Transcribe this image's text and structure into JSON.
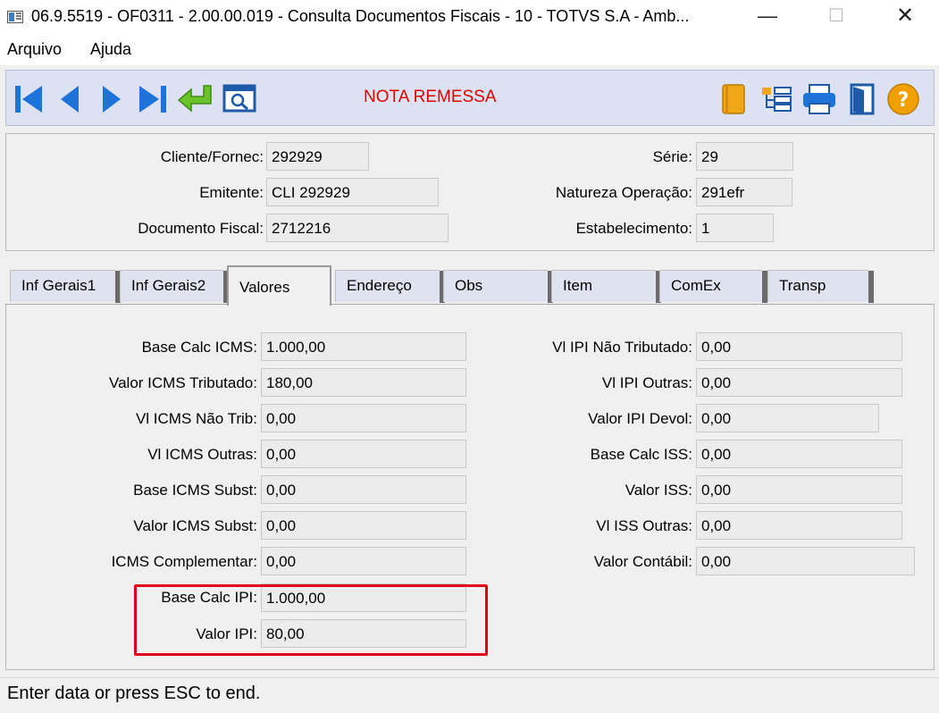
{
  "window": {
    "title": "06.9.5519 - OF0311 - 2.00.00.019 - Consulta Documentos Fiscais - 10 - TOTVS S.A - Amb...",
    "controls": {
      "minimize": "—",
      "maximize": "☐",
      "close": "✕"
    }
  },
  "menu": [
    {
      "label": "Arquivo"
    },
    {
      "label": "Ajuda"
    }
  ],
  "toolbar": {
    "title": "NOTA REMESSA",
    "buttons": [
      "first-record",
      "previous-record",
      "next-record",
      "last-record",
      "go-to",
      "search"
    ],
    "right_buttons": [
      "notebook",
      "tree",
      "print",
      "exit",
      "help"
    ],
    "help_glyph": "?"
  },
  "header": {
    "cliente_label": "Cliente/Fornec:",
    "cliente_value": "292929",
    "emitente_label": "Emitente:",
    "emitente_value": "CLI 292929",
    "documento_label": "Documento Fiscal:",
    "documento_value": "2712216",
    "serie_label": "Série:",
    "serie_value": "29",
    "natureza_label": "Natureza Operação:",
    "natureza_value": "291efr",
    "estabelecimento_label": "Estabelecimento:",
    "estabelecimento_value": "1"
  },
  "tabs": [
    {
      "label": "Inf Gerais1"
    },
    {
      "label": "Inf Gerais2"
    },
    {
      "label": "Valores",
      "active": true
    },
    {
      "label": "Endereço"
    },
    {
      "label": "Obs"
    },
    {
      "label": "Item"
    },
    {
      "label": "ComEx"
    },
    {
      "label": "Transp"
    }
  ],
  "valores": {
    "left": [
      {
        "label": "Base Calc ICMS:",
        "value": "1.000,00"
      },
      {
        "label": "Valor ICMS Tributado:",
        "value": "180,00"
      },
      {
        "label": "Vl  ICMS Não Trib:",
        "value": "0,00"
      },
      {
        "label": "Vl ICMS Outras:",
        "value": "0,00"
      },
      {
        "label": "Base ICMS Subst:",
        "value": "0,00"
      },
      {
        "label": "Valor ICMS Subst:",
        "value": "0,00"
      },
      {
        "label": "ICMS Complementar:",
        "value": "0,00"
      },
      {
        "label": "Base Calc IPI:",
        "value": "1.000,00"
      },
      {
        "label": "Valor IPI:",
        "value": "80,00"
      }
    ],
    "right": [
      {
        "label": "Vl IPI Não Tributado:",
        "value": "0,00"
      },
      {
        "label": "Vl IPI Outras:",
        "value": "0,00"
      },
      {
        "label": "Valor IPI Devol:",
        "value": "0,00"
      },
      {
        "label": "Base Calc ISS:",
        "value": "0,00"
      },
      {
        "label": "Valor ISS:",
        "value": "0,00"
      },
      {
        "label": "Vl  ISS Outras:",
        "value": "0,00"
      },
      {
        "label": "Valor Contábil:",
        "value": "0,00"
      }
    ]
  },
  "highlight": {
    "color": "#e2001a"
  },
  "status": {
    "text": "Enter data or press ESC to end."
  }
}
